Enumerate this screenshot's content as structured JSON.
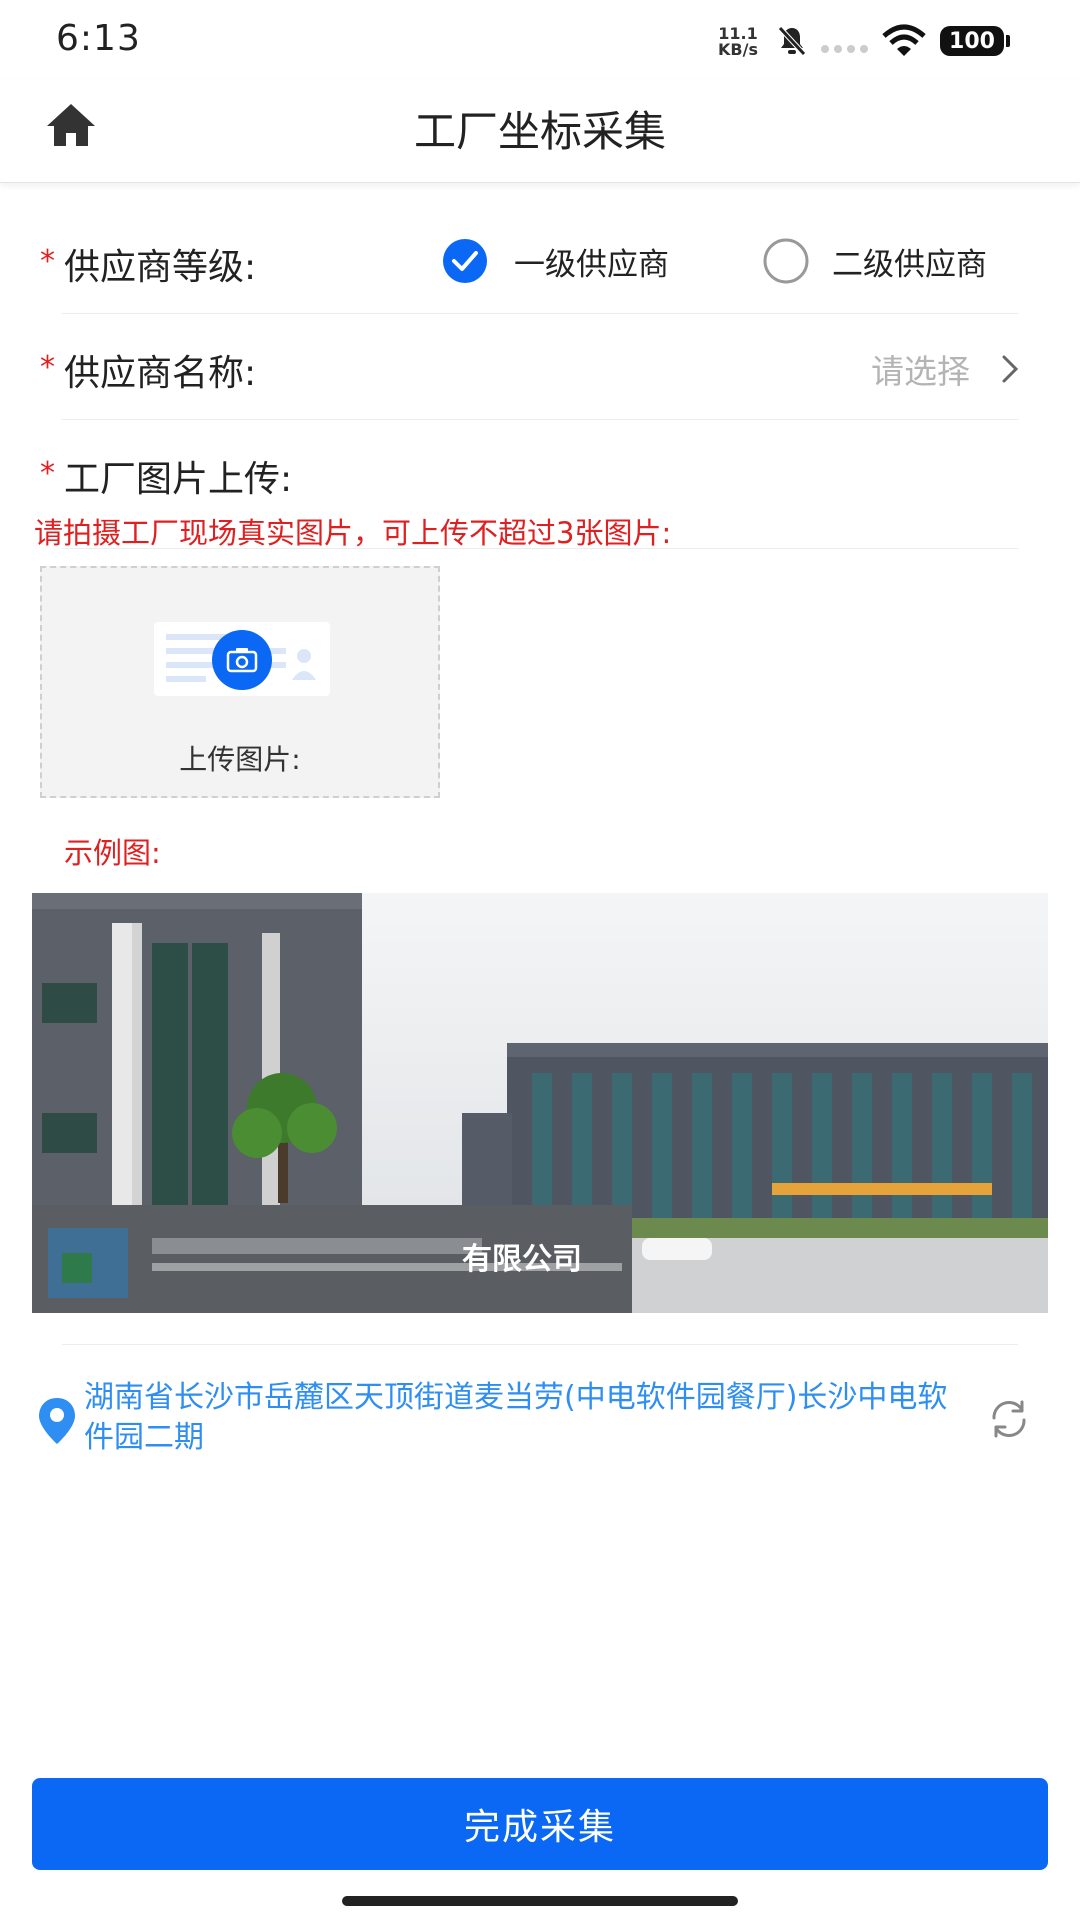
{
  "status_bar": {
    "time": "6:13",
    "speed_value": "11.1",
    "speed_unit": "KB/s",
    "battery": "100"
  },
  "header": {
    "title": "工厂坐标采集",
    "home_icon": "home-icon"
  },
  "form": {
    "supplier_level": {
      "required_mark": "*",
      "label": "供应商等级:",
      "options": [
        {
          "label": "一级供应商",
          "selected": true
        },
        {
          "label": "二级供应商",
          "selected": false
        }
      ]
    },
    "supplier_name": {
      "required_mark": "*",
      "label": "供应商名称:",
      "placeholder": "请选择"
    },
    "factory_images": {
      "required_mark": "*",
      "label": "工厂图片上传:",
      "hint": "请拍摄工厂现场真实图片，可上传不超过3张图片:",
      "upload_label": "上传图片:",
      "example_label": "示例图:",
      "example_sign_text": "有限公司"
    }
  },
  "location": {
    "address": "湖南省长沙市岳麓区天顶街道麦当劳(中电软件园餐厅)长沙中电软件园二期",
    "refresh_icon": "refresh-icon"
  },
  "actions": {
    "finish_label": "完成采集"
  },
  "colors": {
    "primary": "#0a68f5",
    "required": "#e02020",
    "link": "#2f8ef2"
  }
}
